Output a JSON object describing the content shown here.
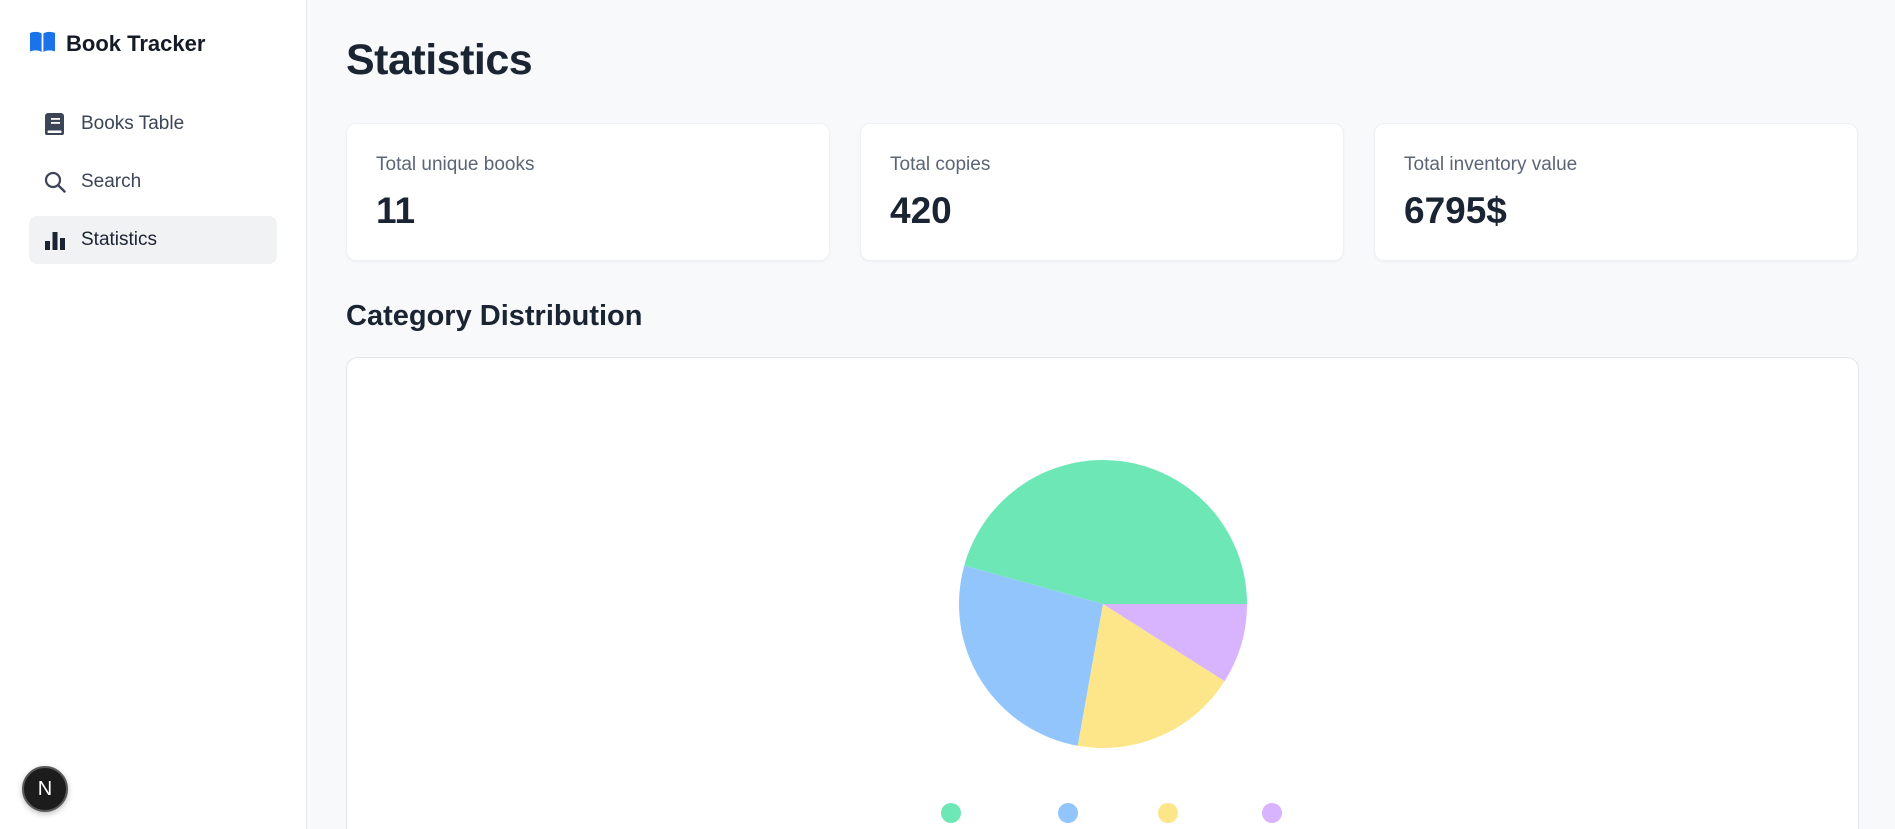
{
  "app": {
    "title": "Book Tracker"
  },
  "sidebar": {
    "items": [
      {
        "label": "Books Table",
        "icon": "book-icon",
        "active": false
      },
      {
        "label": "Search",
        "icon": "search-icon",
        "active": false
      },
      {
        "label": "Statistics",
        "icon": "bar-chart-icon",
        "active": true
      }
    ],
    "badge": {
      "label": "N"
    }
  },
  "main": {
    "title": "Statistics",
    "cards": [
      {
        "label": "Total unique books",
        "value": "11"
      },
      {
        "label": "Total copies",
        "value": "420"
      },
      {
        "label": "Total inventory value",
        "value": "6795$"
      }
    ],
    "section_title": "Category Distribution"
  },
  "colors": {
    "brand": "#1a73e8",
    "green": "#6ee7b7",
    "blue": "#93c5fd",
    "yellow": "#fde68a",
    "purple": "#d8b4fe"
  },
  "chart_data": {
    "type": "pie",
    "categories": [
      "",
      "",
      "",
      ""
    ],
    "values": [
      45.7,
      26.5,
      18.8,
      9.0
    ],
    "colors": [
      "#6ee7b7",
      "#93c5fd",
      "#fde68a",
      "#d8b4fe"
    ],
    "start_angle_deg": 0,
    "direction": "counterclockwise",
    "legend": "bottom"
  }
}
